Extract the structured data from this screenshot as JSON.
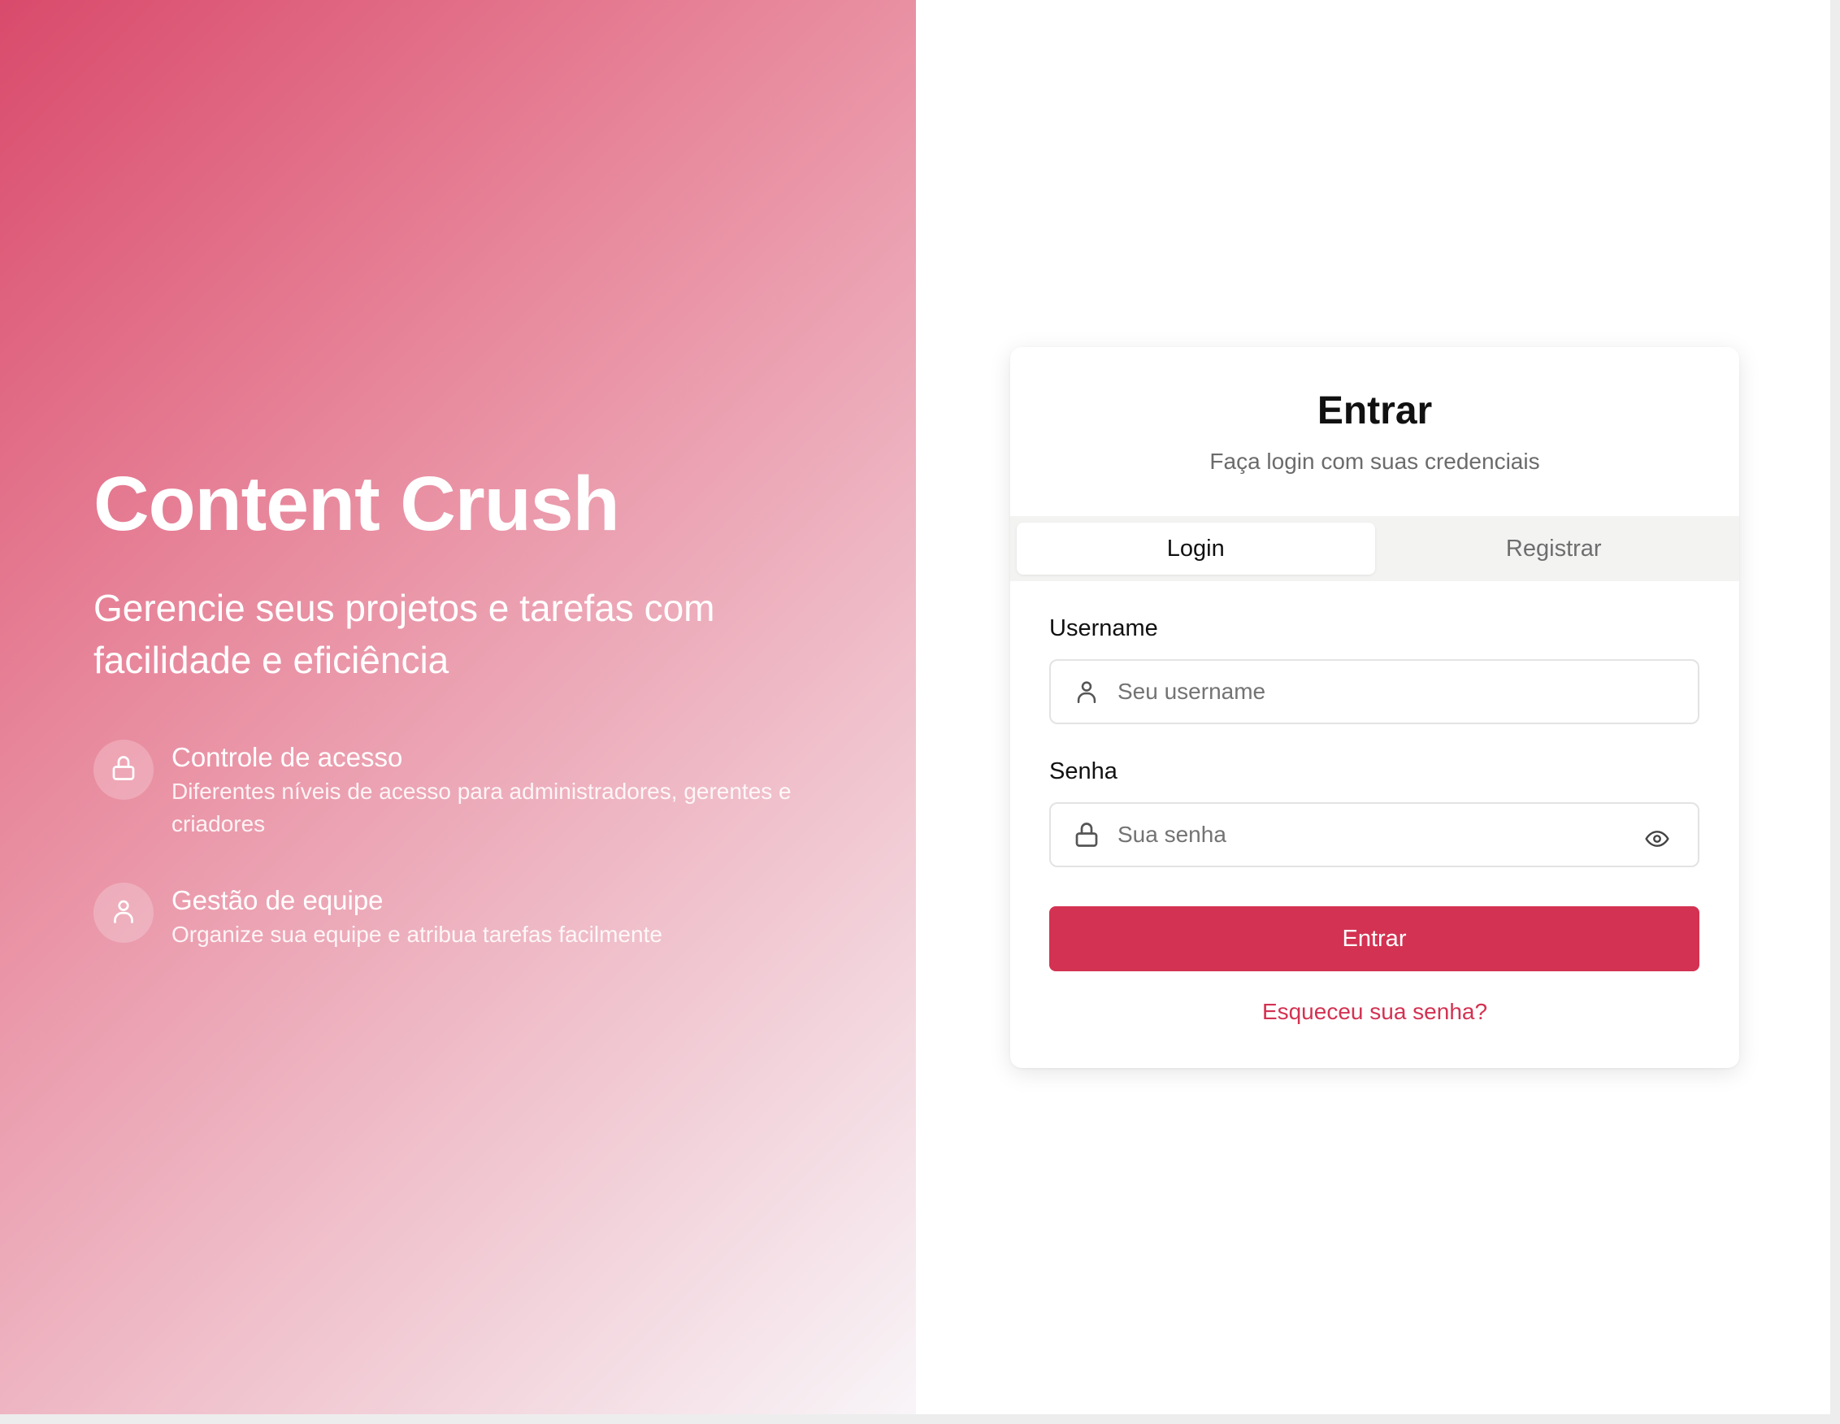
{
  "hero": {
    "title": "Content Crush",
    "subtitle": "Gerencie seus projetos e tarefas com facilidade e eficiência",
    "features": [
      {
        "icon": "lock-icon",
        "title": "Controle de acesso",
        "description": "Diferentes níveis de acesso para administradores, gerentes e criadores"
      },
      {
        "icon": "user-icon",
        "title": "Gestão de equipe",
        "description": "Organize sua equipe e atribua tarefas facilmente"
      }
    ]
  },
  "card": {
    "title": "Entrar",
    "subtitle": "Faça login com suas credenciais",
    "tabs": [
      {
        "label": "Login",
        "active": true
      },
      {
        "label": "Registrar",
        "active": false
      }
    ],
    "username": {
      "label": "Username",
      "placeholder": "Seu username",
      "value": "",
      "icon": "user-icon"
    },
    "password": {
      "label": "Senha",
      "placeholder": "Sua senha",
      "value": "",
      "icon": "lock-icon",
      "toggle_icon": "eye-icon"
    },
    "submit_label": "Entrar",
    "forgot_label": "Esqueceu sua senha?"
  },
  "colors": {
    "accent": "#d33252",
    "gradient_start": "#d94a6b",
    "gradient_end": "#f8f5f8"
  }
}
